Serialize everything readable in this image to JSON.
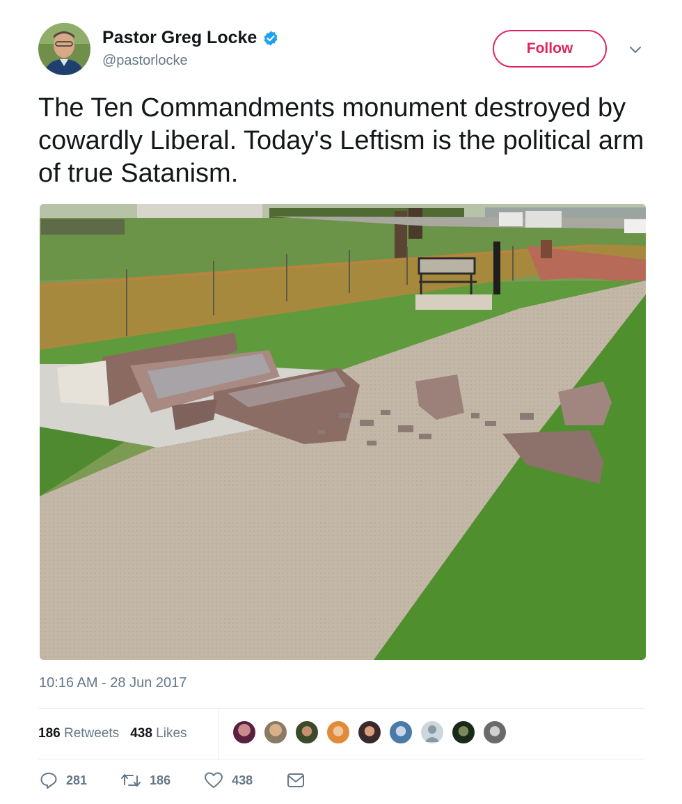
{
  "user": {
    "display_name": "Pastor Greg Locke",
    "handle": "@pastorlocke",
    "verified": true
  },
  "follow_label": "Follow",
  "tweet": {
    "text": "The Ten Commandments monument destroyed by cowardly Liberal. Today's Leftism is the political arm of true Satanism."
  },
  "timestamp": "10:16 AM - 28 Jun 2017",
  "stats": {
    "retweets_count": "186",
    "retweets_label": "Retweets",
    "likes_count": "438",
    "likes_label": "Likes"
  },
  "actions": {
    "replies": "281",
    "retweets": "186",
    "likes": "438"
  },
  "colors": {
    "accent": "#e0245e",
    "verified": "#1da1f2",
    "secondary_text": "#657786",
    "primary_text": "#14171a"
  }
}
